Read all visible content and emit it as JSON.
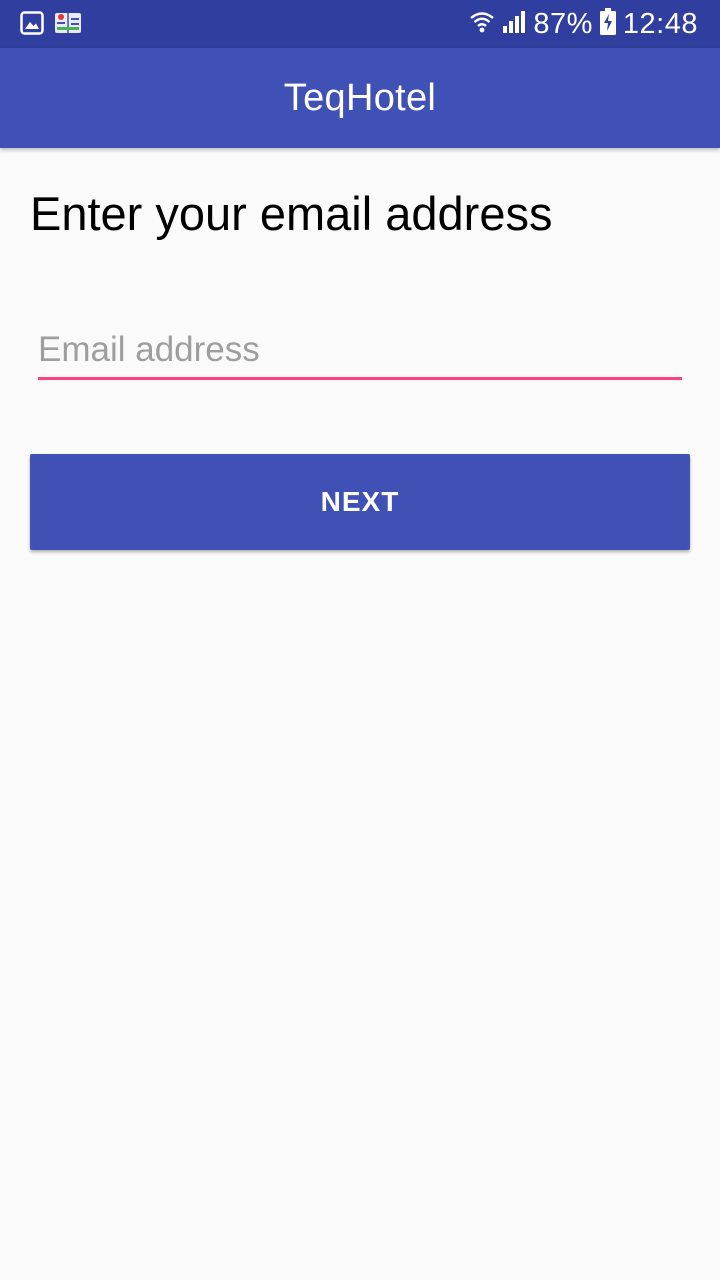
{
  "status_bar": {
    "battery": "87%",
    "time": "12:48",
    "icons": [
      "gallery-icon",
      "book-app-icon",
      "wifi-icon",
      "signal-icon",
      "battery-charging-icon"
    ]
  },
  "app_bar": {
    "title": "TeqHotel"
  },
  "main": {
    "heading": "Enter your email address",
    "email": {
      "value": "",
      "placeholder": "Email address"
    },
    "next_label": "NEXT"
  },
  "colors": {
    "status_bar": "#303f9f",
    "primary": "#3f51b5",
    "accent": "#ff4081",
    "background": "#fafafa"
  }
}
